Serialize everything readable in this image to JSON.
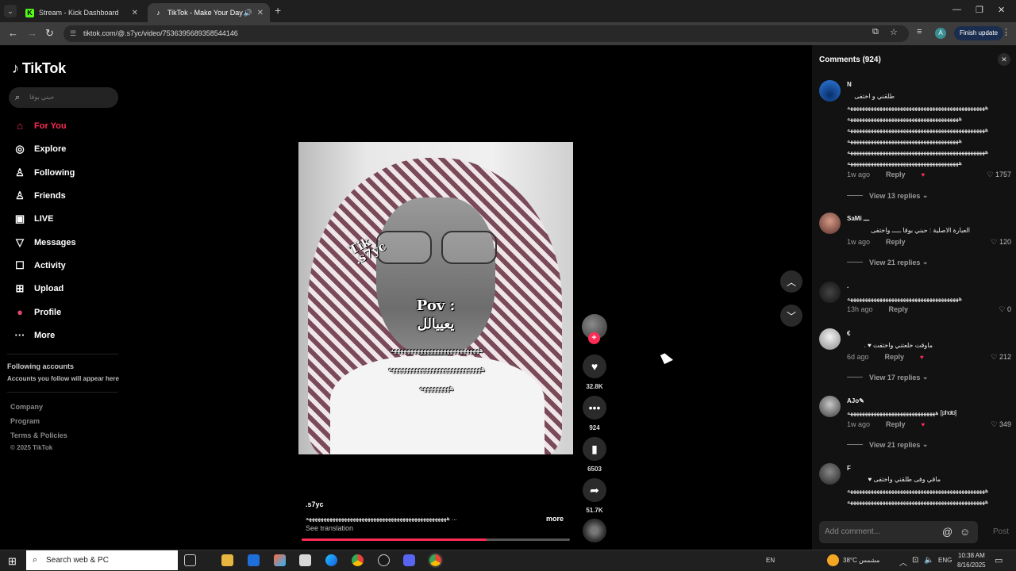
{
  "browser": {
    "tabs": [
      {
        "title": "Stream - Kick Dashboard",
        "favicon": "K",
        "color": "#53fc18"
      },
      {
        "title": "TikTok - Make Your Day",
        "favicon": "♪",
        "color": "#ffffff"
      }
    ],
    "url": "tiktok.com/@.s7yc/video/7536395689358544146",
    "finish_update": "Finish update",
    "profile_letter": "A"
  },
  "sidebar": {
    "logo": "TikTok",
    "search_placeholder": "حبني بوقا",
    "nav": [
      {
        "label": "For You",
        "icon": "home-icon",
        "glyph": "⌂"
      },
      {
        "label": "Explore",
        "icon": "compass-icon",
        "glyph": "◎"
      },
      {
        "label": "Following",
        "icon": "person-icon",
        "glyph": "👤"
      },
      {
        "label": "Friends",
        "icon": "friends-icon",
        "glyph": "👥"
      },
      {
        "label": "LIVE",
        "icon": "live-icon",
        "glyph": "▣"
      },
      {
        "label": "Messages",
        "icon": "messages-icon",
        "glyph": "▽"
      },
      {
        "label": "Activity",
        "icon": "activity-icon",
        "glyph": "☐"
      },
      {
        "label": "Upload",
        "icon": "upload-icon",
        "glyph": "⊞"
      },
      {
        "label": "Profile",
        "icon": "profile-avatar",
        "glyph": "●"
      },
      {
        "label": "More",
        "icon": "more-icon",
        "glyph": "···"
      }
    ],
    "following_heading": "Following accounts",
    "following_sub": "Accounts you follow will appear here",
    "footer_links": [
      "Company",
      "Program",
      "Terms & Policies"
    ],
    "copyright": "© 2025 TikTok"
  },
  "video": {
    "watermark": "Tik\n.s7yc",
    "overlay_title": "Pov :",
    "overlay_arabic": "يعييالل",
    "overlay_lines": [
      "هههههههههههههههههههههههههههه",
      "ههههههههههههههههههههههههههههه",
      "هههههههههه"
    ],
    "author": ".s7yc",
    "description": "ههههههههههههههههههههههههههههههههههههههههههههههههه ...",
    "more": "more",
    "see_translation": "See translation",
    "progress": 0.69,
    "likes": "32.8K",
    "comments": "924",
    "saves": "6503",
    "shares": "51.7K"
  },
  "comments_panel": {
    "title": "Comments (924)",
    "add_placeholder": "Add comment...",
    "post_label": "Post",
    "items": [
      {
        "name": "N",
        "lines": [
          "طلقني و اختفى",
          "هههههههههههههههههههههههههههههههههههههههههههههههه",
          "ههههههههههههههههههههههههههههههههههههههه",
          "هههههههههههههههههههههههههههههههههههههههههههههههه",
          "ههههههههههههههههههههههههههههههههههههههه",
          "هههههههههههههههههههههههههههههههههههههههههههههههه",
          "ههههههههههههههههههههههههههههههههههههههه"
        ],
        "time": "1w ago",
        "reply": "Reply",
        "likes": "1757",
        "view_replies": "View 13 replies",
        "avatar": "#1f5fbf"
      },
      {
        "name": "SaMi ـــ",
        "lines": [
          "العبارة الاصلية : حبني بوقا ـــــ واختفى"
        ],
        "time": "1w ago",
        "reply": "Reply",
        "likes": "120",
        "view_replies": "View 21 replies",
        "avatar": "#b87a6a"
      },
      {
        "name": ".",
        "lines": [
          "ههههههههههههههههههههههههههههههههههههههه"
        ],
        "time": "13h ago",
        "reply": "Reply",
        "likes": "0",
        "view_replies": "",
        "avatar": "#2a2a2a"
      },
      {
        "name": "€",
        "lines": [
          "ماوقت خلعتني واختفت ♥ ."
        ],
        "time": "6d ago",
        "reply": "Reply",
        "likes": "212",
        "view_replies": "View 17 replies",
        "avatar": "#cccccc"
      },
      {
        "name": "AJo✎",
        "lines": [
          "ههههههههههههههههههههههههههههههه [photo]"
        ],
        "time": "1w ago",
        "reply": "Reply",
        "likes": "349",
        "view_replies": "View 21 replies",
        "avatar": "#9a9a9a"
      },
      {
        "name": "F",
        "lines": [
          "ماقي وفى طلقني واختفى ♥",
          "هههههههههههههههههههههههههههههههههههههههههههههههه",
          "هههههههههههههههههههههههههههههههههههههههههههههههه"
        ],
        "time": "",
        "reply": "",
        "likes": "",
        "view_replies": "",
        "avatar": "#5a5a5a"
      }
    ]
  },
  "taskbar": {
    "search_placeholder": "Search web & PC",
    "lang_short": "EN",
    "weather": "38°C مشمس",
    "lang": "ENG",
    "time": "10:38 AM",
    "date": "8/16/2025"
  }
}
